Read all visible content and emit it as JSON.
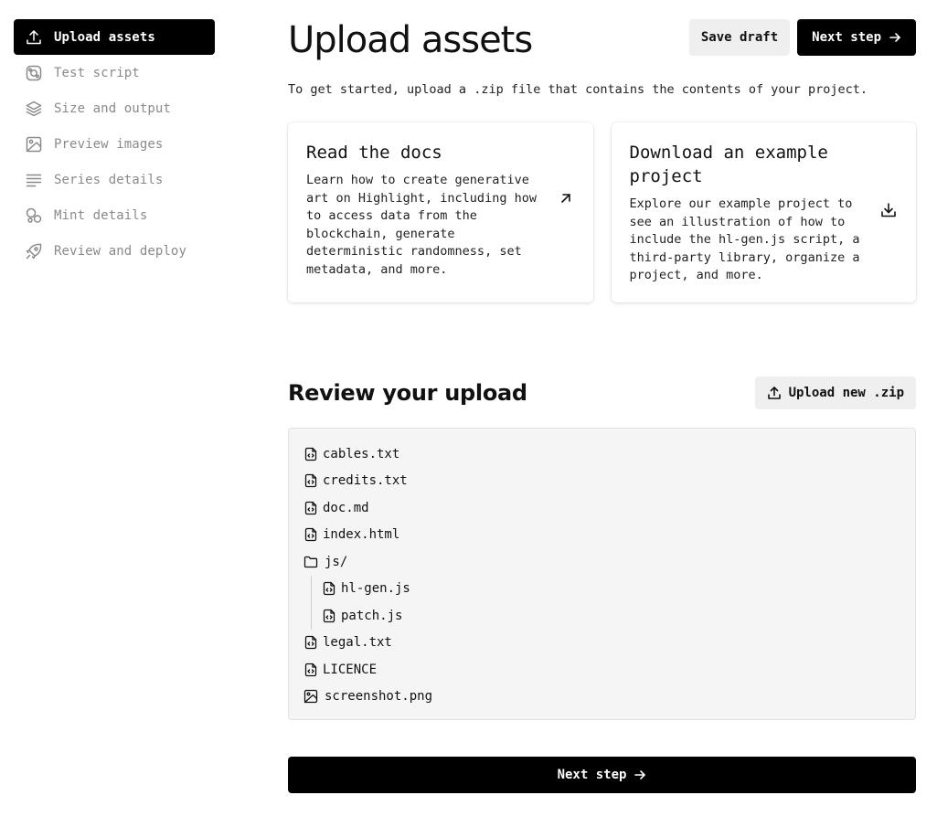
{
  "sidebar": {
    "items": [
      {
        "label": "Upload assets",
        "icon": "upload-icon",
        "active": true
      },
      {
        "label": "Test script",
        "icon": "script-icon",
        "active": false
      },
      {
        "label": "Size and output",
        "icon": "layers-icon",
        "active": false
      },
      {
        "label": "Preview images",
        "icon": "image-icon",
        "active": false
      },
      {
        "label": "Series details",
        "icon": "text-lines-icon",
        "active": false
      },
      {
        "label": "Mint details",
        "icon": "mint-icon",
        "active": false
      },
      {
        "label": "Review and deploy",
        "icon": "rocket-icon",
        "active": false
      }
    ]
  },
  "header": {
    "title": "Upload assets",
    "save_draft_label": "Save draft",
    "next_step_label": "Next step"
  },
  "intro_text": "To get started, upload a .zip file that contains the contents of your project.",
  "cards": [
    {
      "title": "Read the docs",
      "body": "Learn how to create generative art on Highlight, including how to access data from the blockchain, generate deterministic randomness, set metadata, and more.",
      "icon": "arrow-up-right-icon"
    },
    {
      "title": "Download an example project",
      "body": "Explore our example project to see an illustration of how to include the hl-gen.js script, a third-party library, organize a project, and more.",
      "icon": "download-icon"
    }
  ],
  "review": {
    "title": "Review your upload",
    "upload_button_label": "Upload new .zip"
  },
  "files": {
    "cables": "cables.txt",
    "credits": "credits.txt",
    "doc": "doc.md",
    "index": "index.html",
    "js_folder": "js/",
    "hl_gen": "hl-gen.js",
    "patch": "patch.js",
    "legal": "legal.txt",
    "licence": "LICENCE",
    "screenshot": "screenshot.png"
  },
  "footer": {
    "next_step_label": "Next step"
  },
  "colors": {
    "primary": "#000000",
    "secondary_bg": "#efefef",
    "muted_text": "#8a8a8a",
    "panel_bg": "#f5f5f5"
  }
}
